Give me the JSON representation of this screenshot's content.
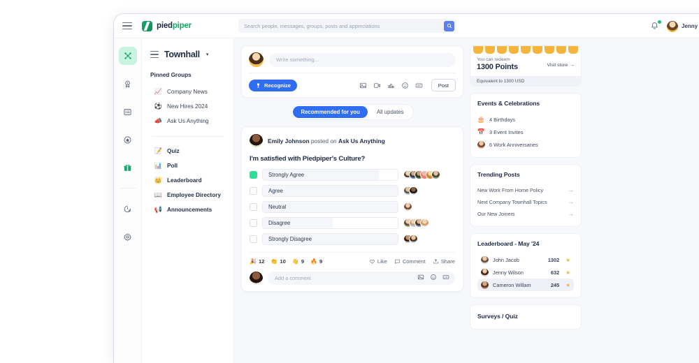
{
  "topbar": {
    "menu_icon": "hamburger-icon",
    "brand_first": "pied",
    "brand_second": "piper",
    "search_placeholder": "Search people, messages, groups, posts and appreciations",
    "search_value": "",
    "search_icon": "search-icon",
    "bell_icon": "bell-icon",
    "user_name": "Jenny",
    "chevron": "⌄"
  },
  "rail": {
    "items": [
      {
        "icon": "hub-network-icon",
        "active": true
      },
      {
        "icon": "award-medal-icon",
        "active": false
      },
      {
        "icon": "list-board-icon",
        "active": false
      },
      {
        "icon": "star-badge-icon",
        "active": false
      },
      {
        "icon": "gift-icon",
        "active": false
      },
      {
        "icon": "analytics-clock-icon",
        "active": false
      },
      {
        "icon": "settings-gear-icon",
        "active": false
      }
    ]
  },
  "sidenav": {
    "menu_icon": "hamburger-icon",
    "title": "Townhall",
    "caret": "▾",
    "pinned_label": "Pinned Groups",
    "pinned": [
      {
        "label": "Company News",
        "icon": "chart-up-icon",
        "emoji": "📈"
      },
      {
        "label": "New Hires 2024",
        "icon": "soccer-ball-icon",
        "emoji": "⚽"
      },
      {
        "label": "Ask Us Anything",
        "icon": "megaphone-icon",
        "emoji": "📣"
      }
    ],
    "items": [
      {
        "label": "Quiz",
        "icon": "quiz-icon",
        "emoji": "📝"
      },
      {
        "label": "Poll",
        "icon": "poll-bars-icon",
        "emoji": "📊"
      },
      {
        "label": "Leaderboard",
        "icon": "crown-icon",
        "emoji": "👑"
      },
      {
        "label": "Employee Directory",
        "icon": "directory-book-icon",
        "emoji": "📖"
      },
      {
        "label": "Announcements",
        "icon": "announcement-icon",
        "emoji": "📢"
      }
    ]
  },
  "composer": {
    "avatar": "user-avatar",
    "placeholder": "Write something...",
    "value": "",
    "recognize_label": "Recognize",
    "recognize_icon": "trophy-icon",
    "tools": [
      "image-icon",
      "video-icon",
      "poll-icon",
      "emoji-icon",
      "gif-icon"
    ],
    "post_label": "Post"
  },
  "tabs": [
    {
      "label": "Recommended for you",
      "active": true
    },
    {
      "label": "All updates",
      "active": false
    }
  ],
  "post": {
    "author": "Emily Johnson",
    "action": "posted on",
    "group": "Ask Us Anything",
    "question": "I'm satisfied with Piedpiper's Culture?",
    "options": [
      {
        "label": "Strongly Agree",
        "selected": true,
        "fill_pct": 86,
        "voters": 6
      },
      {
        "label": "Agree",
        "selected": false,
        "fill_pct": 100,
        "voters": 2
      },
      {
        "label": "Neutral",
        "selected": false,
        "fill_pct": 100,
        "voters": 1
      },
      {
        "label": "Disagree",
        "selected": false,
        "fill_pct": 52,
        "voters": 4
      },
      {
        "label": "Strongly Disagree",
        "selected": false,
        "fill_pct": 100,
        "voters": 2
      }
    ],
    "reactions": [
      {
        "emoji": "🎉",
        "count": "12",
        "name": "party-popper-reaction"
      },
      {
        "emoji": "👏",
        "count": "10",
        "name": "clap-reaction"
      },
      {
        "emoji": "👋",
        "count": "9",
        "name": "wave-reaction"
      },
      {
        "emoji": "🔥",
        "count": "9",
        "name": "fire-reaction"
      }
    ],
    "actions": [
      {
        "label": "Like",
        "icon": "heart-icon"
      },
      {
        "label": "Comment",
        "icon": "comment-icon"
      },
      {
        "label": "Share",
        "icon": "share-icon"
      }
    ],
    "comment_placeholder": "Add a comment",
    "comment_value": "",
    "comment_tools": [
      "image-icon",
      "emoji-icon",
      "gif-icon"
    ]
  },
  "points": {
    "subtitle": "You can redeem",
    "amount": "1300 Points",
    "visit_store": "Visit store",
    "visit_arrow": "→",
    "equivalent": "Equivalent to 1300 USD",
    "scallop_color": "#f5b53c"
  },
  "events": {
    "title": "Events & Celebrations",
    "items": [
      {
        "label": "4 Birthdays",
        "icon": "birthday-cake-icon",
        "emoji": "🎂"
      },
      {
        "label": "3 Event Invites",
        "icon": "calendar-invite-icon",
        "emoji": "📅"
      },
      {
        "label": "6 Work Anniversaries",
        "icon": "anniversary-avatar-icon",
        "emoji": "🎖"
      }
    ]
  },
  "trending": {
    "title": "Trending Posts",
    "arrow": "→",
    "items": [
      {
        "label": "New Work From Home Policy"
      },
      {
        "label": "Next Company Townhall Topics"
      },
      {
        "label": "Our New Joiners"
      }
    ]
  },
  "leaderboard": {
    "title": "Leaderboard - May '24",
    "star": "★",
    "rows": [
      {
        "name": "John Jacob",
        "score": "1302",
        "highlighted": false
      },
      {
        "name": "Jenny Wilson",
        "score": "632",
        "highlighted": false
      },
      {
        "name": "Cameron Willam",
        "score": "245",
        "highlighted": true
      }
    ]
  },
  "surveys": {
    "title": "Surveys / Quiz"
  },
  "colors": {
    "brand_green": "#17a668",
    "accent_blue": "#2f6df2",
    "points_yellow": "#f5b53c",
    "poll_selected": "#2fdd9a"
  }
}
